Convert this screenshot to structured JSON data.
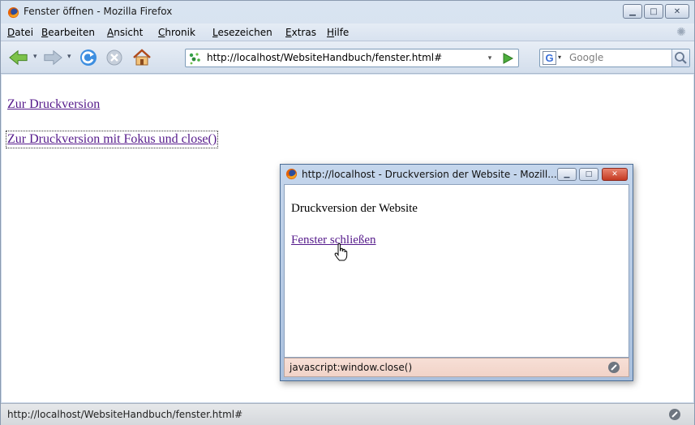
{
  "main_window": {
    "title": "Fenster öffnen - Mozilla Firefox",
    "menu": [
      {
        "accel": "D",
        "rest": "atei"
      },
      {
        "accel": "B",
        "rest": "earbeiten"
      },
      {
        "accel": "A",
        "rest": "nsicht"
      },
      {
        "accel": "C",
        "rest": "hronik"
      },
      {
        "accel": "L",
        "rest": "esezeichen"
      },
      {
        "accel": "E",
        "rest": "xtras"
      },
      {
        "accel": "H",
        "rest": "ilfe"
      }
    ],
    "url": "http://localhost/WebsiteHandbuch/fenster.html#",
    "search": {
      "engine": "G",
      "placeholder": "Google"
    },
    "links": [
      "Zur Druckversion ",
      "Zur Druckversion mit Fokus und close()"
    ],
    "status": "http://localhost/WebsiteHandbuch/fenster.html#"
  },
  "popup_window": {
    "title": "http://localhost - Druckversion der Website - Mozill...",
    "heading": "Druckversion der Website",
    "close_link": "Fenster schließen",
    "status": "javascript:window.close()"
  },
  "colors": {
    "visited_link": "#551a8b",
    "close_button": "#c43a22",
    "popup_status_bg": "#f1d3c8"
  }
}
